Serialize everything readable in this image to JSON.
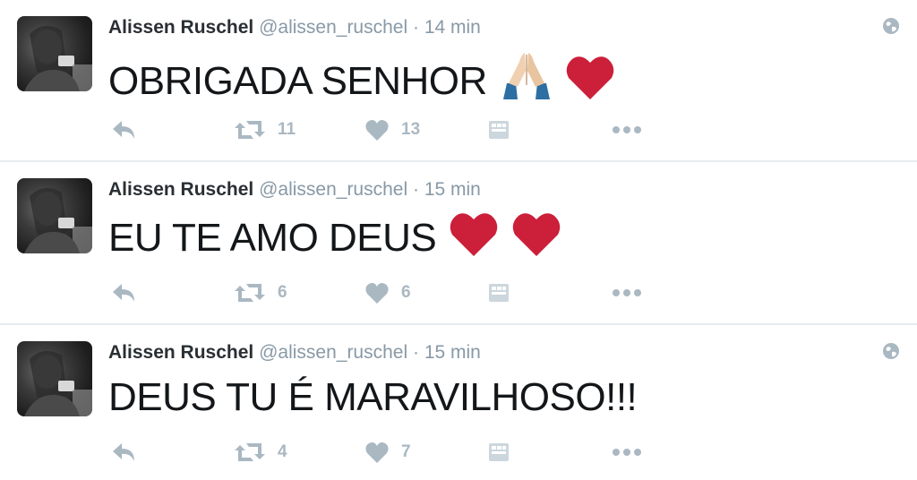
{
  "colors": {
    "name": "#292f33",
    "meta": "#8899a6",
    "action": "#aab8c2",
    "heart": "#cc1f3a",
    "divider": "#e6ecf0"
  },
  "tweets": [
    {
      "name": "Alissen Ruschel",
      "handle": "@alissen_ruschel",
      "separator": "·",
      "time": "14 min",
      "text": "OBRIGADA SENHOR",
      "emojis": [
        "folded-hands-emoji",
        "red-heart-emoji"
      ],
      "retweets": "11",
      "likes": "13",
      "has_globe": true
    },
    {
      "name": "Alissen Ruschel",
      "handle": "@alissen_ruschel",
      "separator": "·",
      "time": "15 min",
      "text": "EU TE AMO DEUS",
      "emojis": [
        "red-heart-emoji",
        "red-heart-emoji"
      ],
      "retweets": "6",
      "likes": "6",
      "has_globe": false
    },
    {
      "name": "Alissen Ruschel",
      "handle": "@alissen_ruschel",
      "separator": "·",
      "time": "15 min",
      "text": "DEUS TU É MARAVILHOSO!!!",
      "emojis": [],
      "retweets": "4",
      "likes": "7",
      "has_globe": true
    }
  ],
  "icons": {
    "reply": "reply-icon",
    "retweet": "retweet-icon",
    "like": "heart-icon",
    "app": "app-card-icon",
    "more": "more-dots-icon",
    "globe": "globe-icon"
  }
}
